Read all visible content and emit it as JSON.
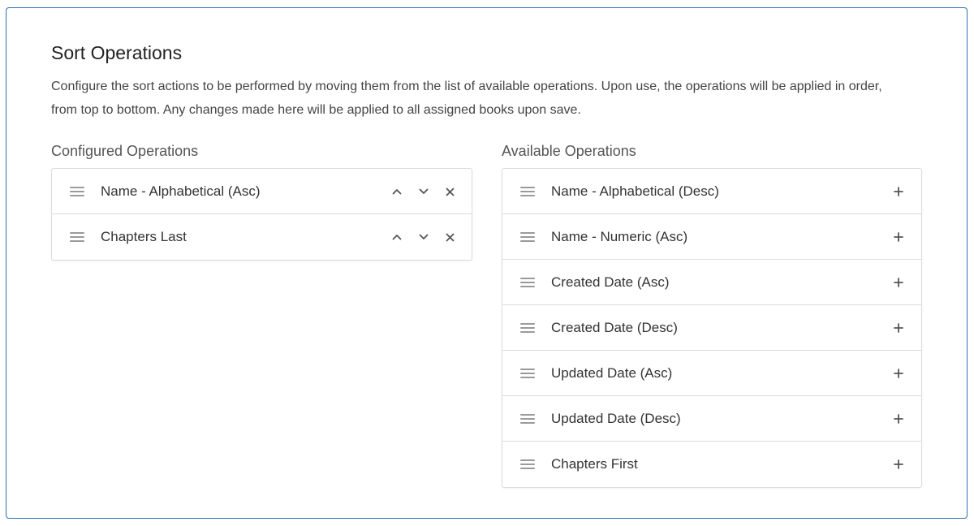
{
  "header": {
    "title": "Sort Operations",
    "description": "Configure the sort actions to be performed by moving them from the list of available operations. Upon use, the operations will be applied in order, from top to bottom. Any changes made here will be applied to all assigned books upon save."
  },
  "configured": {
    "label": "Configured Operations",
    "items": [
      {
        "label": "Name - Alphabetical (Asc)"
      },
      {
        "label": "Chapters Last"
      }
    ]
  },
  "available": {
    "label": "Available Operations",
    "items": [
      {
        "label": "Name - Alphabetical (Desc)"
      },
      {
        "label": "Name - Numeric (Asc)"
      },
      {
        "label": "Created Date (Asc)"
      },
      {
        "label": "Created Date (Desc)"
      },
      {
        "label": "Updated Date (Asc)"
      },
      {
        "label": "Updated Date (Desc)"
      },
      {
        "label": "Chapters First"
      }
    ]
  },
  "colors": {
    "frame_border": "#2f6fb0",
    "divider": "#dcdcdc",
    "icon": "#555555"
  },
  "icons": {
    "drag": "drag-handle-icon",
    "up": "chevron-up-icon",
    "down": "chevron-down-icon",
    "remove": "close-icon",
    "add": "plus-icon"
  }
}
